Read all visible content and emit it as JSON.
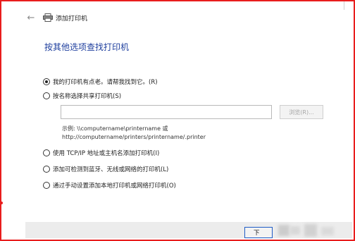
{
  "header": {
    "back_icon": "back-arrow-icon",
    "printer_icon": "printer-icon",
    "title": "添加打印机"
  },
  "heading": "按其他选项查找打印机",
  "options": [
    {
      "label": "我的打印机有点老。请帮我找到它。(R)",
      "checked": true
    },
    {
      "label": "按名称选择共享打印机(S)",
      "checked": false
    },
    {
      "label": "使用 TCP/IP 地址或主机名添加打印机(I)",
      "checked": false
    },
    {
      "label": "添加可检测到蓝牙、无线或网络的打印机(L)",
      "checked": false
    },
    {
      "label": "通过手动设置添加本地打印机或网络打印机(O)",
      "checked": false
    }
  ],
  "shared_printer": {
    "input_value": "",
    "browse_label": "浏览(R)...",
    "example_line1": "示例: \\\\computername\\printername 或",
    "example_line2": "http://computername/printers/printername/.printer"
  },
  "footer": {
    "next_label": "下"
  },
  "colors": {
    "frame_border": "#e81d1d",
    "heading": "#1f3f9e",
    "next_border": "#1e5bc6"
  }
}
